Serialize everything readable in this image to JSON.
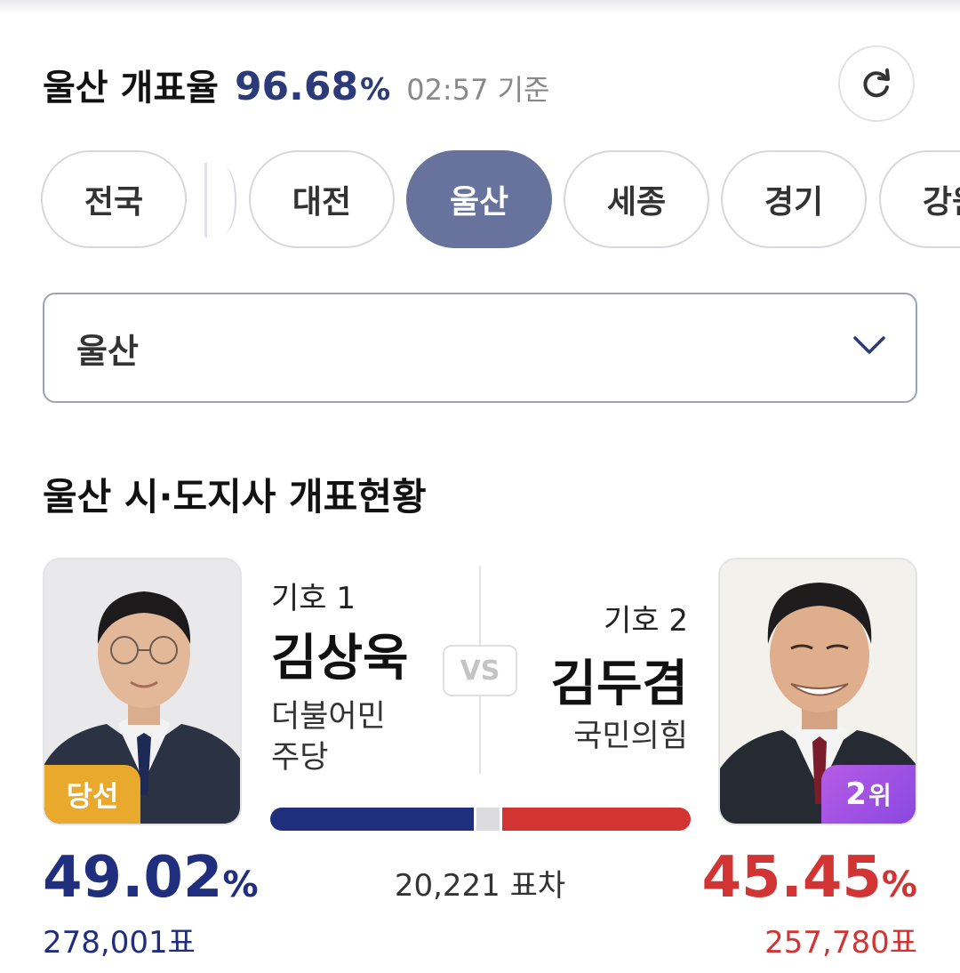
{
  "header": {
    "title": "울산 개표율",
    "rate": "96.68",
    "rate_unit": "%",
    "time": "02:57 기준"
  },
  "tabs": [
    {
      "label": "전국",
      "active": false
    },
    {
      "label": "대전",
      "active": false
    },
    {
      "label": "울산",
      "active": true
    },
    {
      "label": "세종",
      "active": false
    },
    {
      "label": "경기",
      "active": false
    },
    {
      "label": "강원",
      "active": false
    }
  ],
  "region_select": {
    "value": "울산"
  },
  "section_title": "울산 시·도지사 개표현황",
  "candidates": [
    {
      "number": "기호 1",
      "name": "김상욱",
      "party_line1": "더불어민",
      "party_line2": "주당",
      "badge": "당선",
      "percent": "49.02",
      "percent_unit": "%",
      "votes": "278,001표",
      "color": "#1f2f7e"
    },
    {
      "number": "기호 2",
      "name": "김두겸",
      "party_line1": "국민의힘",
      "badge_num": "2",
      "badge_unit": "위",
      "percent": "45.45",
      "percent_unit": "%",
      "votes": "257,780표",
      "color": "#d23434"
    }
  ],
  "vs_label": "VS",
  "vote_gap": "20,221 표차",
  "share": {
    "candidate1": 49.02,
    "candidate2": 45.45,
    "others": 5.53
  },
  "colors": {
    "accent": "#67739c",
    "party1": "#1f2f7e",
    "party2": "#d23434",
    "win_badge": "#e8a92c",
    "rank_badge": "#9b4fe3"
  },
  "icons": [
    "refresh-icon",
    "chevron-down-icon",
    "laurel-icon"
  ]
}
